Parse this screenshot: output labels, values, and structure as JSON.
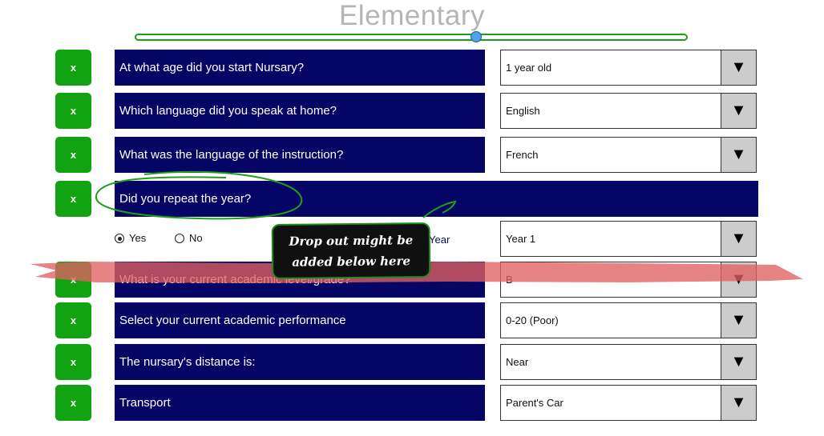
{
  "title": "Elementary",
  "slider": {
    "label": "Elementary",
    "value": 0.62
  },
  "rows": [
    {
      "question": "At what age did you start Nursary?",
      "answer": "1 year old",
      "clear_label": "x"
    },
    {
      "question": "Which language did you speak at home?",
      "answer": "English",
      "clear_label": "x"
    },
    {
      "question": "What was the language of the instruction?",
      "answer": "French",
      "clear_label": "x"
    },
    {
      "question": "Did you repeat the year?",
      "clear_label": "x"
    },
    {
      "question": "What is your current academic level/grade?",
      "answer": "B",
      "clear_label": "x"
    },
    {
      "question": "Select your current academic performance",
      "answer": "0-20 (Poor)",
      "clear_label": "x"
    },
    {
      "question": "The nursary's distance is:",
      "answer": "Near",
      "clear_label": "x"
    },
    {
      "question": "Transport",
      "answer": "Parent's Car",
      "clear_label": "x"
    }
  ],
  "repeat": {
    "options": [
      {
        "label": "Yes",
        "selected": true
      },
      {
        "label": "No",
        "selected": false
      }
    ],
    "year_label": "Year",
    "year_value": "Year 1"
  },
  "dropdown_arrow": "▼",
  "annotation": {
    "note": "Drop out might be added below  here"
  },
  "colors": {
    "question_bg": "#050566",
    "clear_button": "#12a312",
    "strike": "#e06060",
    "annotation_border": "#1d8e1d"
  }
}
